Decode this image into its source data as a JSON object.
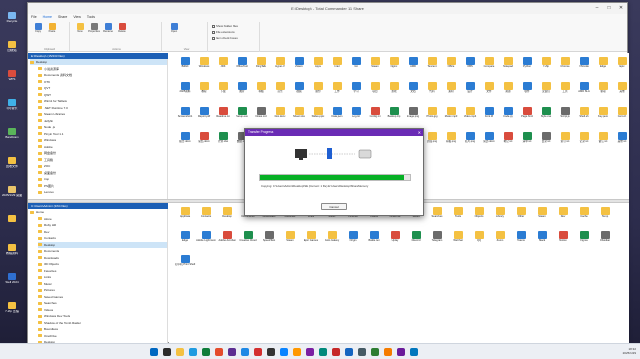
{
  "window": {
    "title": "E:\\Desktop\\ - Total Commander 11 Share"
  },
  "ribbon": {
    "tabs": [
      "File",
      "Home",
      "Share",
      "View",
      "Tools"
    ],
    "groups": [
      {
        "label": "Clipboard",
        "buttons": [
          "Copy",
          "Paste"
        ]
      },
      {
        "label": "Actions",
        "buttons": [
          "New",
          "Properties",
          "Rename",
          "Delete"
        ]
      },
      {
        "label": "View",
        "buttons": [
          "Open"
        ]
      }
    ],
    "checks": [
      "Show hidden files",
      "File extensions",
      "Item check boxes"
    ]
  },
  "top_pane": {
    "header": "E:\\Desktop\\  (15/233 files)",
    "tree": [
      "Desktop",
      "小说资源库",
      "Documents 资料文档",
      "OTK",
      "QVT",
      "QWT",
      "Win11 for Tablets",
      ".NET Runtime 7.0",
      "Steam Libraries",
      "Jellyfin",
      "Node .js",
      "Pinyin Tool 1.1",
      "Windows",
      "Adobe",
      "网盘备份",
      "工具箱",
      "ZOC",
      "桌面备份",
      "tmp",
      "PS图片",
      "Lenovo"
    ],
    "files": [
      [
        "Bilibili",
        "Windows",
        "JDK",
        "OfficeTool",
        "DingTalk",
        "Hyper-V",
        "Zotero",
        "Apps",
        "Intel",
        "Git",
        "Steam",
        "Nginx",
        "AMD",
        "Tencent",
        "Office",
        "OBS",
        "Compare",
        "Notepad",
        "Python",
        "7-Zip",
        "Chrome",
        "VSCode",
        "Edge",
        "Epic"
      ],
      [
        "2025资料",
        "教程",
        "下载",
        "图片",
        "书籍",
        "音乐",
        "视频",
        "备份",
        "工作",
        "学习",
        "项目",
        "游戏",
        "文档",
        "代码",
        "素材",
        "设计",
        "文件",
        "资源",
        "软件",
        "安装包",
        "工具",
        "AMD SLA",
        "驱动",
        "其他"
      ],
      [
        "Screenshot1",
        "Report.pdf",
        "Readme.txt",
        "Setup.exe",
        "Notes.md",
        "Doc.docx",
        "Sheet.xlsx",
        "Slides.pptx",
        "Data.json",
        "Log.txt",
        "Config.ini",
        "Backup.zip",
        "Image.png",
        "Photo.jpg",
        "Music.mp3",
        "Video.mp4",
        "Font.ttf",
        "Code.py",
        "Page.html",
        "Style.css",
        "Script.js",
        "Shell.sh",
        "Key.pem",
        "Cert.crt"
      ],
      [
        "报告.docx",
        "总结.docx",
        "计划.xlsx",
        "数据.xlsx",
        "表格.xlsx",
        "方案.pptx",
        "演示.pptx",
        "合同.pdf",
        "发票.pdf",
        "说明.pdf",
        "截图.png",
        "照片.jpg",
        "图标.ico",
        "封面.png",
        "海报.png",
        "名片.png",
        "简历.docx",
        "笔记.txt",
        "清单.txt",
        "目录.txt",
        "索引.txt",
        "记录.txt",
        "备忘.txt",
        "其他.txt"
      ]
    ]
  },
  "bottom_pane": {
    "header": "C:\\Users\\Admin\\  (3/64 files)",
    "tree": [
      "Home",
      "Alone",
      "Ruby Hill",
      "Dev",
      "Contacts",
      "Desktop",
      "Documents",
      "Downloads",
      "3D Objects",
      "Favorites",
      "Links",
      "Music",
      "Pictures",
      "Saved Games",
      "Searches",
      "Videos",
      "Windows Dev Tools",
      "Shadow of the Tomb Raider",
      "Boundless",
      "OneDrive",
      "Desktop"
    ],
    "files_row1": [
      "AppData",
      "Contacts",
      "Desktop",
      "Documents",
      "Downloads",
      "Favorites",
      "Links",
      "Music",
      "Pictures",
      "Videos",
      "OneDrive",
      "Saved",
      "Searches",
      "Tools",
      "Objects",
      "Library",
      "Other",
      "Steam",
      "Dev",
      "Cache",
      "Temp"
    ],
    "files_row2": [
      "Edge",
      "Adobe Lightroom",
      "Adobe Acrobat",
      "Creative Cloud",
      "SpeedTest",
      "Steam",
      "Epic Games",
      "GoG Galaxy",
      "Origin",
      "Battle.net",
      "Uplay",
      "Discord",
      "Telegram",
      "WeChat",
      "QQ",
      "Zoom",
      "Teams",
      "Slack",
      "Notion",
      "Figma",
      "Obsidian"
    ],
    "files_row3": [
      "打印机 Print Shell"
    ]
  },
  "dialog": {
    "title": "Transfer Progress",
    "progress_pct": 96,
    "copy_text": "Copying: C:\\Users\\Admin\\Desktop\\SE  (Current: 1 file)  E:\\Users\\Desktop\\ShareMemory",
    "cancel_label": "Cancel"
  },
  "desktop_icons": [
    "Recycle",
    "回收站",
    "WPS",
    "QQ音乐",
    "Bandicam",
    "回收文件",
    "2025/1/29 桌面",
    "",
    "教程资料",
    "Stell 2024",
    "7-Zip 压缩"
  ],
  "taskbar": {
    "tray_time": "18:32",
    "tray_date": "2025/1/29"
  },
  "colors": {
    "accent": "#1c5fb5",
    "dialog_title": "#6a2bb5",
    "progress": "#06b025",
    "folder": "#f4c142"
  }
}
